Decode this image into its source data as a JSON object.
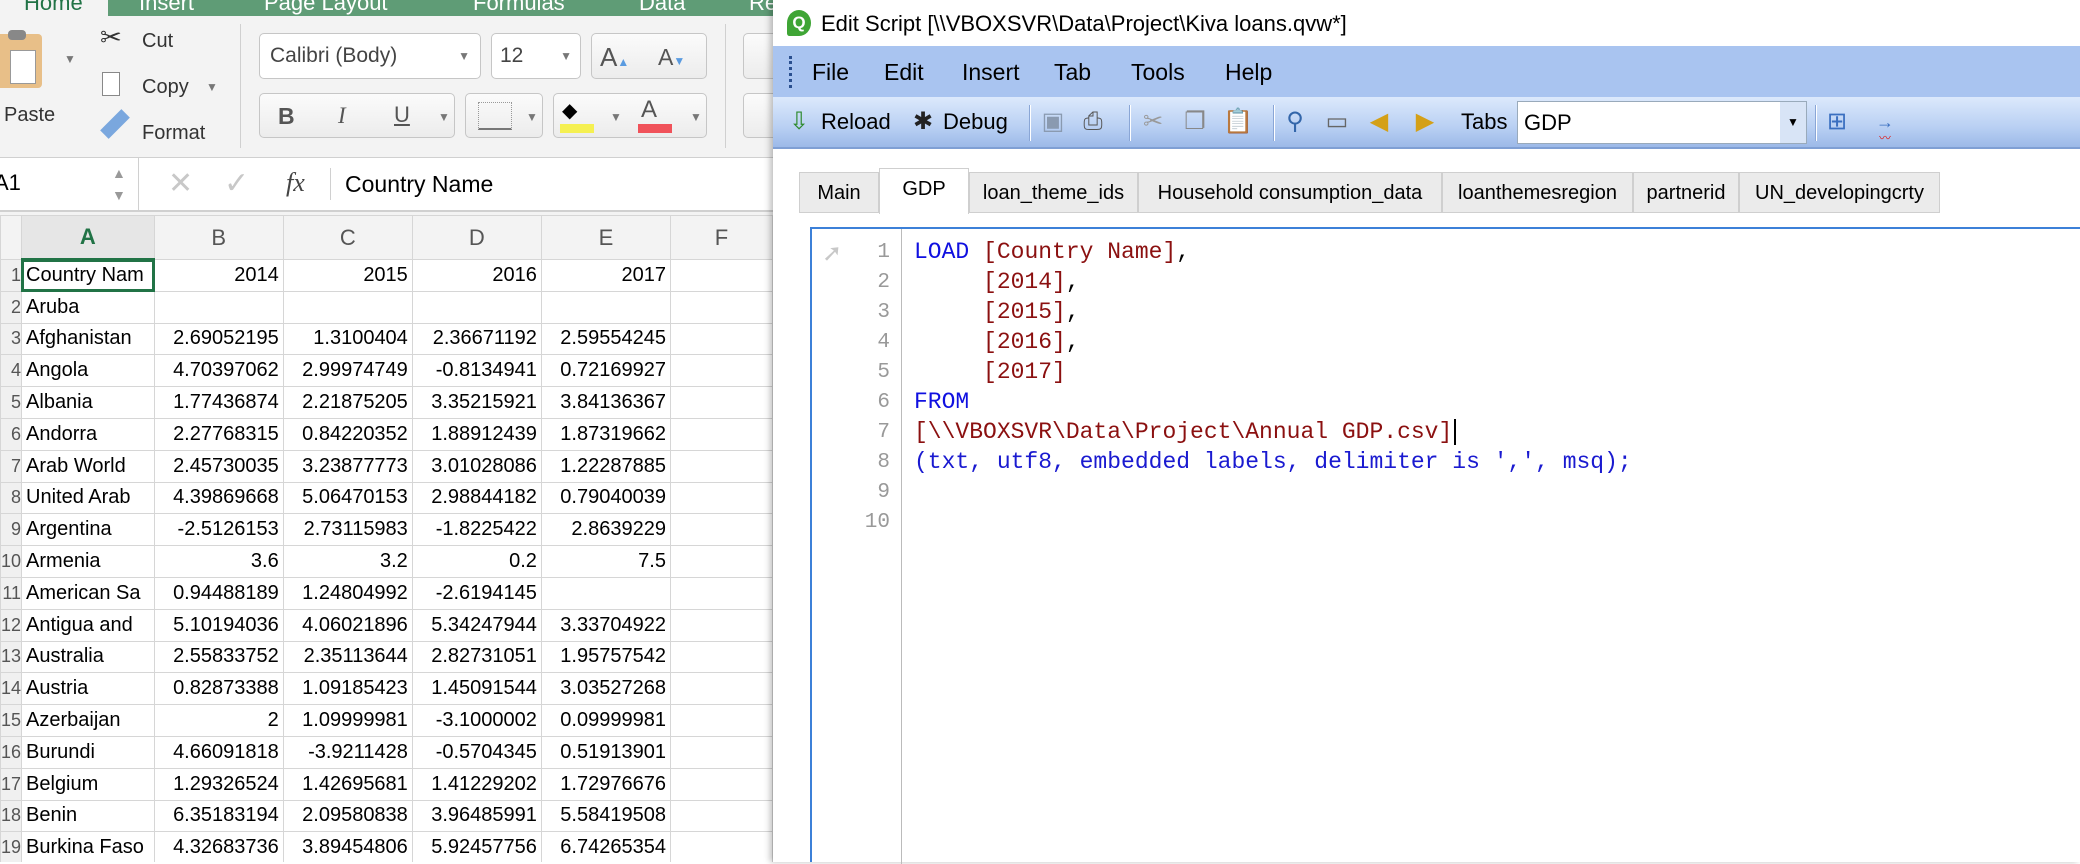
{
  "excel": {
    "ribbon_tabs": [
      "Home",
      "Insert",
      "Page Layout",
      "Formulas",
      "Data",
      "Re"
    ],
    "clipboard": {
      "paste": "Paste",
      "cut": "Cut",
      "copy": "Copy",
      "format": "Format"
    },
    "font": {
      "name": "Calibri (Body)",
      "size": "12",
      "bold": "B",
      "italic": "I",
      "underline": "U",
      "grow": "A",
      "shrink": "A",
      "font_color_letter": "A",
      "fill_color": "#f5f051",
      "font_color": "#f0525a"
    },
    "name_box": "A1",
    "fx": "fx",
    "formula": "Country Name",
    "columns": [
      "A",
      "B",
      "C",
      "D",
      "E",
      "F"
    ],
    "selected_column": "A",
    "rows": [
      {
        "n": "1",
        "c": [
          "Country Nam",
          "2014",
          "2015",
          "2016",
          "2017",
          ""
        ]
      },
      {
        "n": "2",
        "c": [
          "Aruba",
          "",
          "",
          "",
          "",
          ""
        ]
      },
      {
        "n": "3",
        "c": [
          "Afghanistan",
          "2.69052195",
          "1.3100404",
          "2.36671192",
          "2.59554245",
          ""
        ]
      },
      {
        "n": "4",
        "c": [
          "Angola",
          "4.70397062",
          "2.99974749",
          "-0.8134941",
          "0.72169927",
          ""
        ]
      },
      {
        "n": "5",
        "c": [
          "Albania",
          "1.77436874",
          "2.21875205",
          "3.35215921",
          "3.84136367",
          ""
        ]
      },
      {
        "n": "6",
        "c": [
          "Andorra",
          "2.27768315",
          "0.84220352",
          "1.88912439",
          "1.87319662",
          ""
        ]
      },
      {
        "n": "7",
        "c": [
          "Arab World",
          "2.45730035",
          "3.23877773",
          "3.01028086",
          "1.22287885",
          ""
        ]
      },
      {
        "n": "8",
        "c": [
          "United Arab",
          "4.39869668",
          "5.06470153",
          "2.98844182",
          "0.79040039",
          ""
        ]
      },
      {
        "n": "9",
        "c": [
          "Argentina",
          "-2.5126153",
          "2.73115983",
          "-1.8225422",
          "2.8639229",
          ""
        ]
      },
      {
        "n": "10",
        "c": [
          "Armenia",
          "3.6",
          "3.2",
          "0.2",
          "7.5",
          ""
        ]
      },
      {
        "n": "11",
        "c": [
          "American Sa",
          "0.94488189",
          "1.24804992",
          "-2.6194145",
          "",
          ""
        ]
      },
      {
        "n": "12",
        "c": [
          "Antigua and",
          "5.10194036",
          "4.06021896",
          "5.34247944",
          "3.33704922",
          ""
        ]
      },
      {
        "n": "13",
        "c": [
          "Australia",
          "2.55833752",
          "2.35113644",
          "2.82731051",
          "1.95757542",
          ""
        ]
      },
      {
        "n": "14",
        "c": [
          "Austria",
          "0.82873388",
          "1.09185423",
          "1.45091544",
          "3.03527268",
          ""
        ]
      },
      {
        "n": "15",
        "c": [
          "Azerbaijan",
          "2",
          "1.09999981",
          "-3.1000002",
          "0.09999981",
          ""
        ]
      },
      {
        "n": "16",
        "c": [
          "Burundi",
          "4.66091818",
          "-3.9211428",
          "-0.5704345",
          "0.51913901",
          ""
        ]
      },
      {
        "n": "17",
        "c": [
          "Belgium",
          "1.29326524",
          "1.42695681",
          "1.41229202",
          "1.72976676",
          ""
        ]
      },
      {
        "n": "18",
        "c": [
          "Benin",
          "6.35183194",
          "2.09580838",
          "3.96485991",
          "5.58419508",
          ""
        ]
      },
      {
        "n": "19",
        "c": [
          "Burkina Faso",
          "4.32683736",
          "3.89454806",
          "5.92457756",
          "6.74265354",
          ""
        ]
      }
    ]
  },
  "qlik": {
    "title": "Edit Script [\\\\VBOXSVR\\Data\\Project\\Kiva loans.qvw*]",
    "menu": [
      "File",
      "Edit",
      "Insert",
      "Tab",
      "Tools",
      "Help"
    ],
    "toolbar": {
      "reload": "Reload",
      "debug": "Debug",
      "tabs_label": "Tabs",
      "tabs_value": "GDP"
    },
    "script_tabs": [
      "Main",
      "GDP",
      "loan_theme_ids",
      "Household consumption_data",
      "loanthemesregion",
      "partnerid",
      "UN_developingcrty"
    ],
    "active_tab": "GDP",
    "line_numbers": [
      "1",
      "2",
      "3",
      "4",
      "5",
      "6",
      "7",
      "8",
      "9",
      "10"
    ],
    "code": {
      "l1_kw": "LOAD",
      "l1_f": "[Country Name]",
      "l1_p": ",",
      "l2_f": "[2014]",
      "l2_p": ",",
      "l3_f": "[2015]",
      "l3_p": ",",
      "l4_f": "[2016]",
      "l4_p": ",",
      "l5_f": "[2017]",
      "l6_kw": "FROM",
      "l7_f": "[\\\\VBOXSVR\\Data\\Project\\Annual GDP.csv]",
      "l8": "(txt, utf8, embedded labels, delimiter is ',', msq);"
    }
  }
}
